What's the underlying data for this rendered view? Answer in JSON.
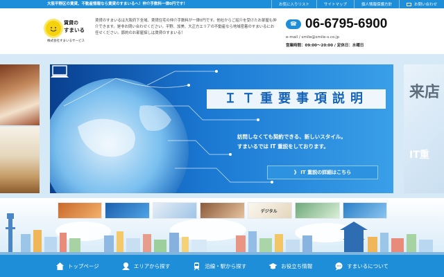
{
  "topbar": {
    "tagline": "大阪平野区の賃貸、不動産情報なら賃貸のすまいるへ！仲介手数料一律0円です！",
    "links": [
      "お気に入りリスト",
      "サイトマップ",
      "個人情報保護方針",
      "お問い合わせ"
    ]
  },
  "logo": {
    "line1": "賃貸の",
    "line2": "すまいる",
    "company": "株式会社すまいるサービス"
  },
  "intro": "賃貸のすまいるは大阪府下全域、賃貸住宅の仲介手数料が一律0円です。他社からご紹介を受けたお部屋も仲介できます。是非お問い合わせください。平野、加美、大正方エリアの不動産なら地域密着のすまいるにお任せください。節約のお部屋探しは賃貸のすまいる！",
  "contact": {
    "phone": "06-6795-6900",
    "email": "e-mail / smile@smile-s.co.jp",
    "hours": "営業時間：09:00〜20:00 / 定休日：水曜日"
  },
  "hero": {
    "title": "ＩＴ重要事項説明",
    "line1": "訪問しなくても契約できる、新しいスタイル。",
    "line2": "すまいるでは IT 重説をしております。",
    "button": "》 IT 重説の詳細はこちら"
  },
  "side_right": {
    "text1": "来店",
    "text2": "IT重"
  },
  "thumbs": [
    {
      "label": "",
      "color": "#c9692b"
    },
    {
      "label": "",
      "color": "#2a7fc8"
    },
    {
      "label": "",
      "color": "#7fb0d8"
    },
    {
      "label": "",
      "color": "#b48a6a"
    },
    {
      "label": "デジタル",
      "color": "#e9e2d6"
    },
    {
      "label": "",
      "color": "#9fc7a8"
    },
    {
      "label": "",
      "color": "#3d8fd0"
    }
  ],
  "nav": [
    {
      "label": "トップページ",
      "icon": "home-icon"
    },
    {
      "label": "エリアから探す",
      "icon": "map-icon"
    },
    {
      "label": "沿線・駅から探す",
      "icon": "train-icon"
    },
    {
      "label": "お役立ち情報",
      "icon": "graduation-cap-icon"
    },
    {
      "label": "すまいるについて",
      "icon": "speech-bubble-icon"
    }
  ],
  "colors": {
    "brand": "#1e8ed8",
    "brand_dark": "#0a3f8f",
    "logo_sun": "#f5d20c"
  }
}
